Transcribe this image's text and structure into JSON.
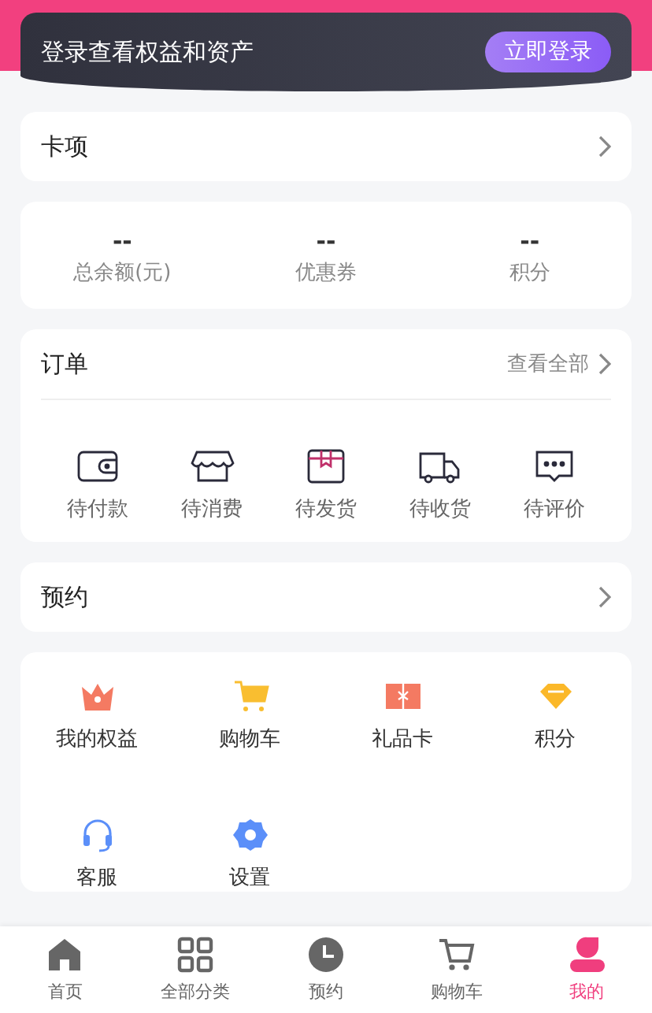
{
  "login_banner": {
    "text": "登录查看权益和资产",
    "button": "立即登录"
  },
  "cards_row": {
    "label": "卡项"
  },
  "balances": [
    {
      "value": "--",
      "label": "总余额(元)"
    },
    {
      "value": "--",
      "label": "优惠券"
    },
    {
      "value": "--",
      "label": "积分"
    }
  ],
  "orders": {
    "title": "订单",
    "view_all": "查看全部",
    "statuses": [
      "待付款",
      "待消费",
      "待发货",
      "待收货",
      "待评价"
    ]
  },
  "booking_row": {
    "label": "预约"
  },
  "services": [
    "我的权益",
    "购物车",
    "礼品卡",
    "积分",
    "客服",
    "设置"
  ],
  "tab_bar": [
    {
      "label": "首页",
      "selected": false
    },
    {
      "label": "全部分类",
      "selected": false
    },
    {
      "label": "预约",
      "selected": false
    },
    {
      "label": "购物车",
      "selected": false
    },
    {
      "label": "我的",
      "selected": true
    }
  ]
}
